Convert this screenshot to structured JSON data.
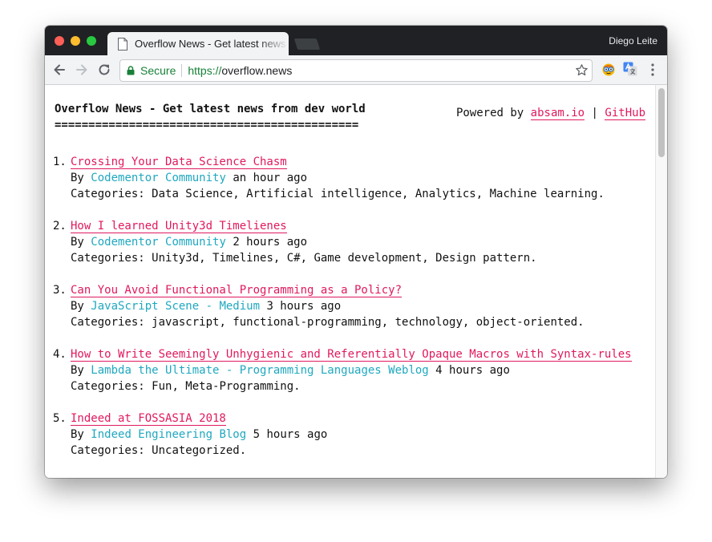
{
  "browser": {
    "tab_title": "Overflow News - Get latest news from dev world",
    "user_name": "Diego Leite",
    "secure_label": "Secure",
    "url_scheme": "https://",
    "url_host": "overflow.news"
  },
  "page": {
    "title": "Overflow News - Get latest news from dev world",
    "title_underline": "=============================================",
    "powered_by_label": "Powered by",
    "powered_by_link": "absam.io",
    "separator": "|",
    "github_link": "GitHub",
    "by_label": "By",
    "categories_label": "Categories:"
  },
  "news": [
    {
      "num": "1.",
      "title": "Crossing Your Data Science Chasm",
      "source": "Codementor Community",
      "time": "an hour ago",
      "categories": "Data Science, Artificial intelligence, Analytics, Machine learning."
    },
    {
      "num": "2.",
      "title": "How I learned Unity3d Timelienes",
      "source": "Codementor Community",
      "time": "2 hours ago",
      "categories": "Unity3d, Timelines, C#, Game development, Design pattern."
    },
    {
      "num": "3.",
      "title": "Can You Avoid Functional Programming as a Policy?",
      "source": "JavaScript Scene - Medium",
      "time": "3 hours ago",
      "categories": "javascript, functional-programming, technology, object-oriented."
    },
    {
      "num": "4.",
      "title": "How to Write Seemingly Unhygienic and Referentially Opaque Macros with Syntax-rules",
      "source": "Lambda the Ultimate - Programming Languages Weblog",
      "time": "4 hours ago",
      "categories": "Fun, Meta-Programming."
    },
    {
      "num": "5.",
      "title": "Indeed at FOSSASIA 2018",
      "source": "Indeed Engineering Blog",
      "time": "5 hours ago",
      "categories": "Uncategorized."
    }
  ],
  "colors": {
    "link": "#e0195f",
    "source": "#1fa8c0",
    "secure": "#188038",
    "titlebar": "#202124"
  }
}
